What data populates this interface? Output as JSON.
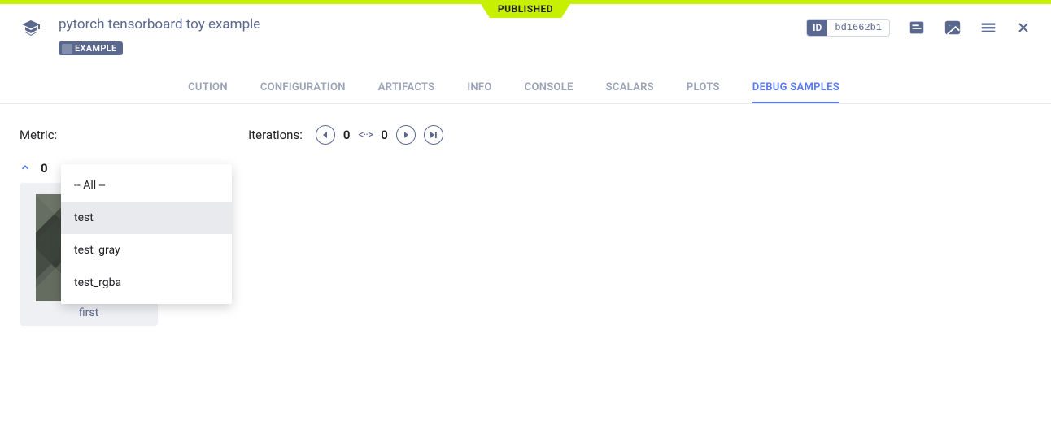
{
  "status_banner": "PUBLISHED",
  "title": "pytorch tensorboard toy example",
  "example_chip": "EXAMPLE",
  "id_label": "ID",
  "id_value": "bd1662b1",
  "tabs": {
    "execution": "CUTION",
    "configuration": "CONFIGURATION",
    "artifacts": "ARTIFACTS",
    "info": "INFO",
    "console": "CONSOLE",
    "scalars": "SCALARS",
    "plots": "PLOTS",
    "debug_samples": "DEBUG SAMPLES"
  },
  "controls": {
    "metric_label": "Metric:",
    "iterations_label": "Iterations:",
    "iter_start": "0",
    "iter_end": "0"
  },
  "dropdown": {
    "items": [
      {
        "label": "-- All --"
      },
      {
        "label": "test"
      },
      {
        "label": "test_gray"
      },
      {
        "label": "test_rgba"
      }
    ],
    "selected_index": 1
  },
  "iteration_group": {
    "number": "0"
  },
  "thumbnail": {
    "label": "first"
  }
}
